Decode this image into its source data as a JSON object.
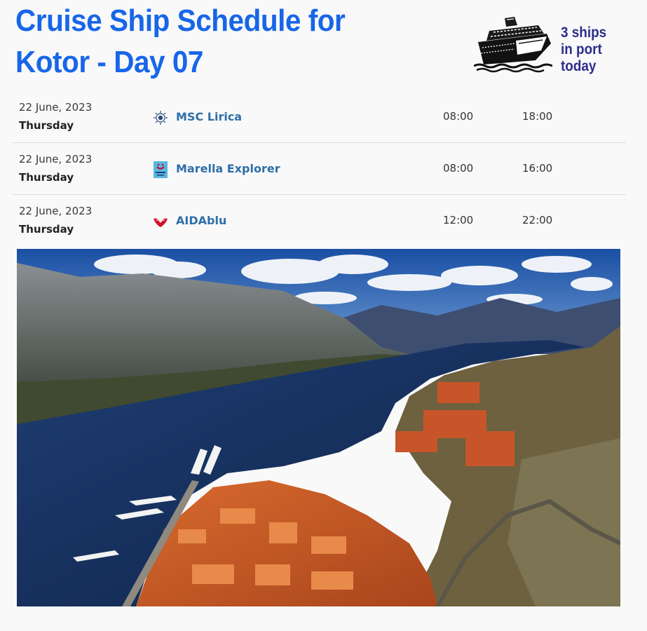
{
  "header": {
    "title_line1": "Cruise Ship Schedule for",
    "title_line2": "Kotor - Day 07",
    "ships_line1": "3 ships",
    "ships_line2": "in port",
    "ships_line3": "today",
    "title_color": "#1766e8",
    "count_color": "#2e2e8a"
  },
  "schedule": [
    {
      "date": "22 June, 2023",
      "day": "Thursday",
      "ship": "MSC Lirica",
      "line_icon": "msc-cruises-logo-icon",
      "arrive": "08:00",
      "depart": "18:00"
    },
    {
      "date": "22 June, 2023",
      "day": "Thursday",
      "ship": "Marella Explorer",
      "line_icon": "marella-cruises-logo-icon",
      "arrive": "08:00",
      "depart": "16:00"
    },
    {
      "date": "22 June, 2023",
      "day": "Thursday",
      "ship": "AIDAblu",
      "line_icon": "aida-cruises-logo-icon",
      "arrive": "12:00",
      "depart": "22:00"
    }
  ],
  "colors": {
    "link": "#2f6fa8",
    "divider": "#dcdcdc",
    "background": "#f9f9f9"
  },
  "photo": {
    "subject": "aerial view of the Bay of Kotor with the old town and cruise ships"
  }
}
